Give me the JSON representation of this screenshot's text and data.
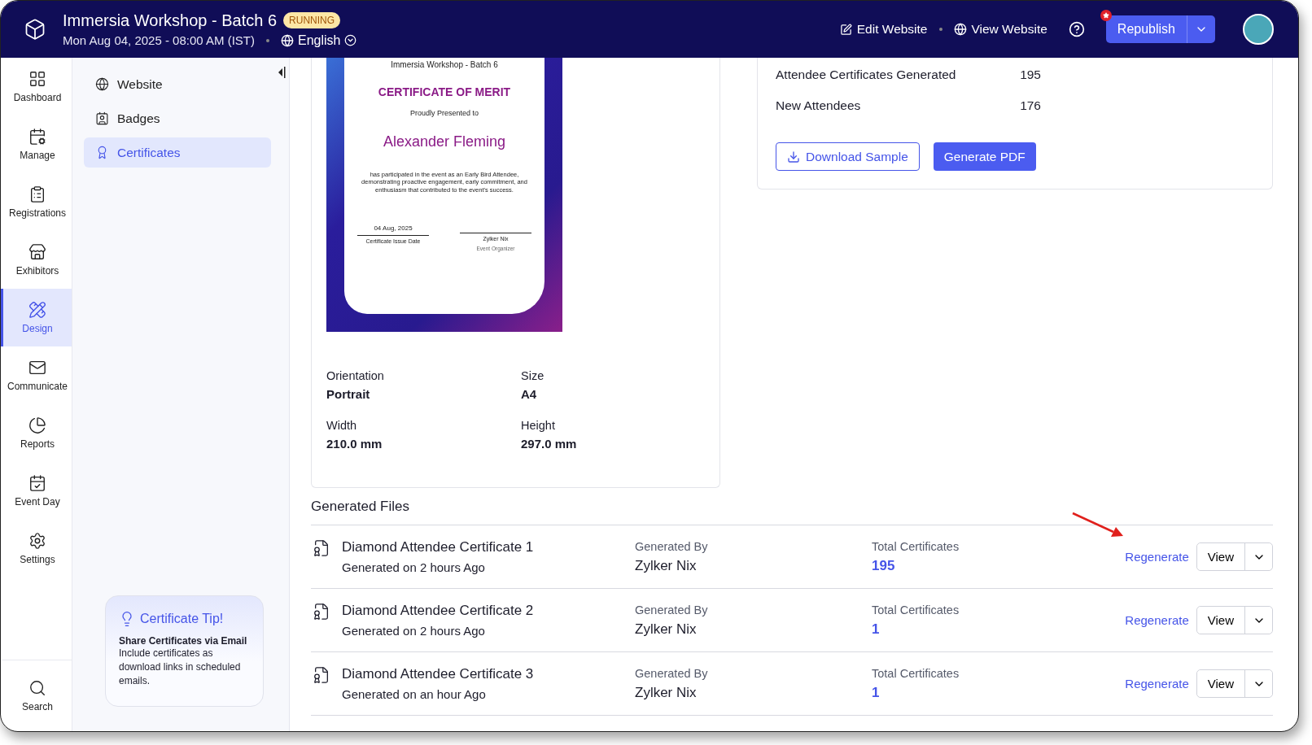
{
  "header": {
    "title": "Immersia Workshop - Batch 6",
    "status": "RUNNING",
    "datetime": "Mon Aug 04, 2025 - 08:00 AM (IST)",
    "language": "English",
    "edit_link": "Edit Website",
    "view_link": "View Website",
    "publish_button": "Republish",
    "publish_notification": true
  },
  "sidebar": {
    "items": [
      {
        "label": "Dashboard",
        "kind": "dashboard",
        "selected": false
      },
      {
        "label": "Manage",
        "kind": "manage",
        "selected": false
      },
      {
        "label": "Registrations",
        "kind": "registrations",
        "selected": false
      },
      {
        "label": "Exhibitors",
        "kind": "exhibitors",
        "selected": false
      },
      {
        "label": "Design",
        "kind": "design",
        "selected": true
      },
      {
        "label": "Communicate",
        "kind": "communicate",
        "selected": false
      },
      {
        "label": "Reports",
        "kind": "reports",
        "selected": false
      },
      {
        "label": "Event Day",
        "kind": "eventday",
        "selected": false
      },
      {
        "label": "Settings",
        "kind": "settings",
        "selected": false
      }
    ],
    "search": "Search"
  },
  "subnav": {
    "items": [
      {
        "label": "Website",
        "kind": "website",
        "selected": false
      },
      {
        "label": "Badges",
        "kind": "badges",
        "selected": false
      },
      {
        "label": "Certificates",
        "kind": "certificates",
        "selected": true
      }
    ],
    "tip": {
      "title": "Certificate Tip!",
      "heading": "Share Certificates via Email",
      "body": "Include certificates as download links in scheduled emails."
    }
  },
  "certificate": {
    "event": "Immersia Workshop - Batch 6",
    "heading": "CERTIFICATE OF MERIT",
    "presented": "Proudly Presented to",
    "recipient": "Alexander Fleming",
    "body": "has participated in the event as an Early Bird Attendee, demonstrating proactive engagement, early commitment, and enthusiasm that contributed to the event's success.",
    "date": "04 Aug, 2025",
    "date_label": "Certificate Issue Date",
    "signer": "Zylker Nix",
    "signer_role": "Event Organizer"
  },
  "properties": [
    {
      "label": "Orientation",
      "value": "Portrait"
    },
    {
      "label": "Size",
      "value": "A4"
    },
    {
      "label": "Width",
      "value": "210.0 mm"
    },
    {
      "label": "Height",
      "value": "297.0 mm"
    }
  ],
  "summary": {
    "stats": [
      {
        "label": "Attendee Certificates Generated",
        "value": "195"
      },
      {
        "label": "New Attendees",
        "value": "176"
      }
    ],
    "download_button": "Download Sample",
    "generate_button": "Generate PDF"
  },
  "generated_files": {
    "title": "Generated Files",
    "rows": [
      {
        "name": "Diamond Attendee Certificate 1",
        "generated": "Generated on 2 hours Ago",
        "by_label": "Generated By",
        "by": "Zylker Nix",
        "total_label": "Total Certificates",
        "total": "195",
        "regenerate": "Regenerate",
        "view": "View",
        "annotated": true
      },
      {
        "name": "Diamond Attendee Certificate 2",
        "generated": "Generated on 2 hours Ago",
        "by_label": "Generated By",
        "by": "Zylker Nix",
        "total_label": "Total Certificates",
        "total": "1",
        "regenerate": "Regenerate",
        "view": "View",
        "annotated": false
      },
      {
        "name": "Diamond Attendee Certificate 3",
        "generated": "Generated on an hour Ago",
        "by_label": "Generated By",
        "by": "Zylker Nix",
        "total_label": "Total Certificates",
        "total": "1",
        "regenerate": "Regenerate",
        "view": "View",
        "annotated": false
      }
    ]
  }
}
